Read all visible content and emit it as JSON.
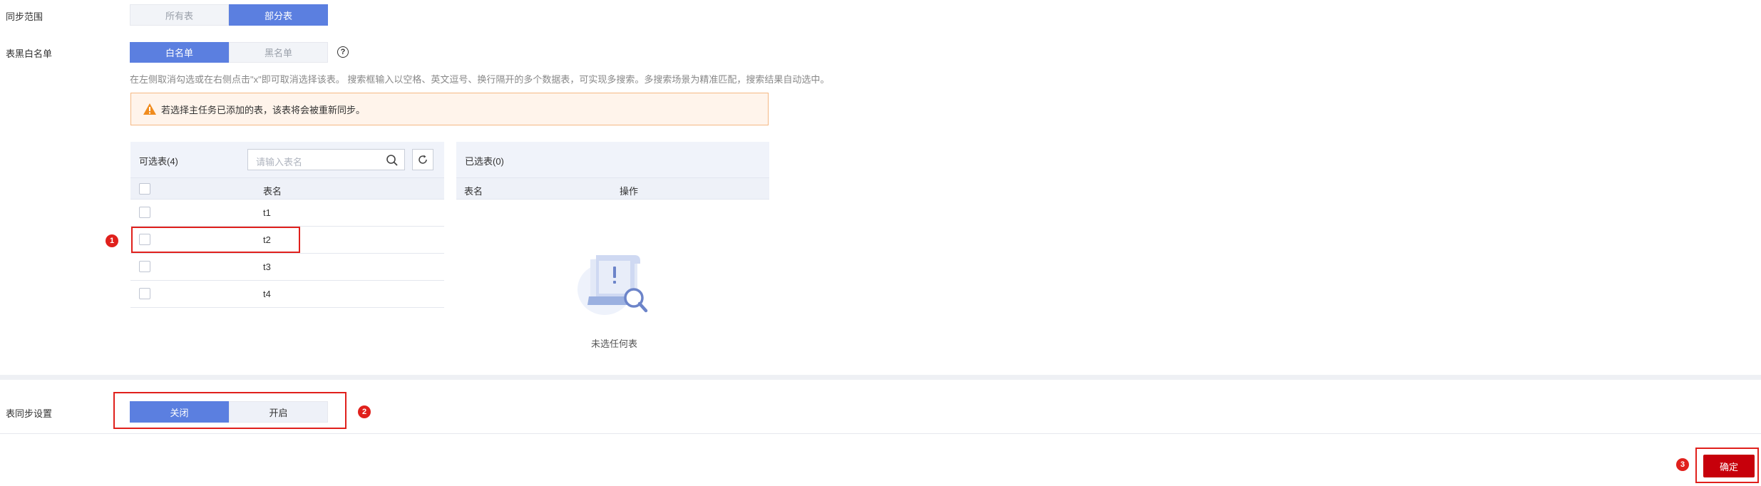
{
  "sync_scope": {
    "label": "同步范围",
    "options": [
      "所有表",
      "部分表"
    ],
    "selected": "部分表"
  },
  "table_list": {
    "label": "表黑白名单",
    "options": [
      "白名单",
      "黑名单"
    ],
    "selected": "白名单",
    "help_icon": "question-circle-icon",
    "hint": "在左侧取消勾选或在右侧点击\"x\"即可取消选择该表。 搜索框输入以空格、英文逗号、换行隔开的多个数据表，可实现多搜索。多搜索场景为精准匹配，搜索结果自动选中。"
  },
  "warning": {
    "icon": "warning-triangle-icon",
    "text": "若选择主任务已添加的表，该表将会被重新同步。"
  },
  "available": {
    "title": "可选表(4)",
    "search_placeholder": "请输入表名",
    "column_name": "表名",
    "rows": [
      "t1",
      "t2",
      "t3",
      "t4"
    ]
  },
  "selected": {
    "title": "已选表(0)",
    "columns": [
      "表名",
      "操作"
    ],
    "empty_text": "未选任何表"
  },
  "table_sync": {
    "label": "表同步设置",
    "options": [
      "关闭",
      "开启"
    ],
    "selected": "关闭"
  },
  "markers": [
    "1",
    "2",
    "3"
  ],
  "confirm_label": "确定",
  "colors": {
    "primary": "#5b7fe0",
    "confirm": "#c7000b",
    "annotation": "#e0201c",
    "warning_bg": "#fff4eb"
  }
}
